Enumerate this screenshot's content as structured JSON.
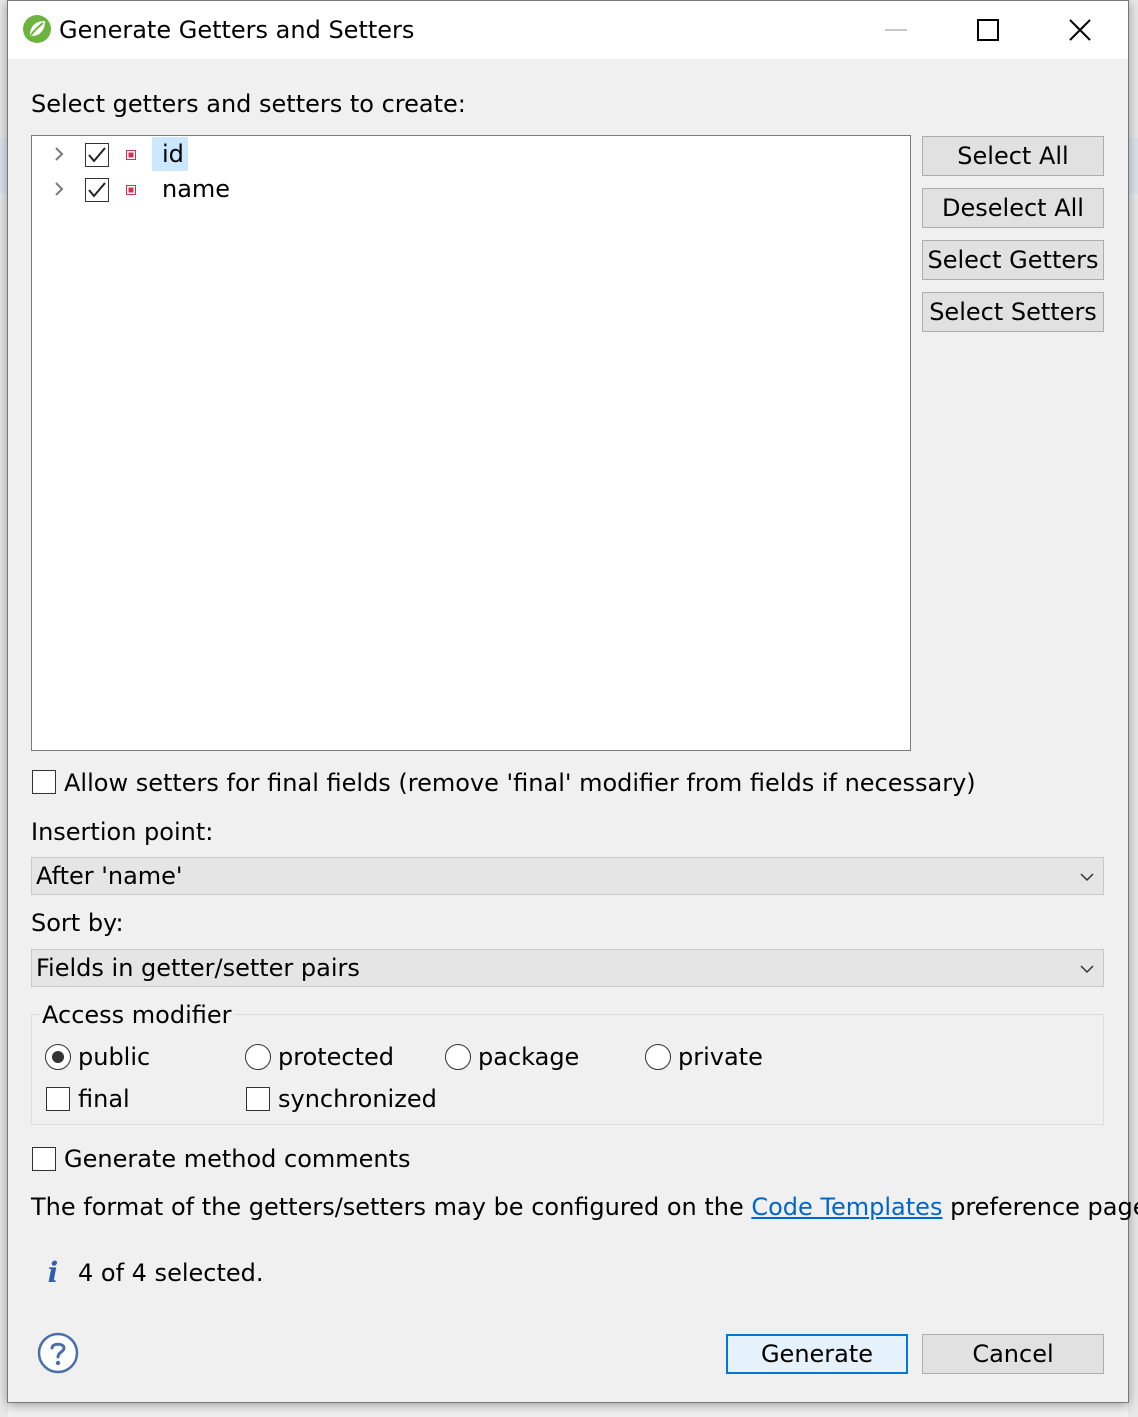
{
  "dialog": {
    "title": "Generate Getters and Setters",
    "minimize_icon": "minimize-icon",
    "maximize_icon": "maximize-icon",
    "close_icon": "close-icon"
  },
  "fields_section": {
    "label": "Select getters and setters to create:",
    "tree": [
      {
        "name": "id",
        "checked": true,
        "selected": true,
        "icon": "private-field-icon"
      },
      {
        "name": "name",
        "checked": true,
        "selected": false,
        "icon": "private-field-icon"
      }
    ]
  },
  "side_buttons": {
    "select_all": "Select All",
    "deselect_all": "Deselect All",
    "select_getters": "Select Getters",
    "select_setters": "Select Setters"
  },
  "allow_setters_final": {
    "label": "Allow setters for final fields (remove 'final' modifier from fields if necessary)",
    "checked": false
  },
  "insertion_point": {
    "label": "Insertion point:",
    "value": "After 'name'"
  },
  "sort_by": {
    "label": "Sort by:",
    "value": "Fields in getter/setter pairs"
  },
  "access_modifier": {
    "title": "Access modifier",
    "options": [
      "public",
      "protected",
      "package",
      "private"
    ],
    "selected": "public",
    "final_label": "final",
    "synchronized_label": "synchronized",
    "final_checked": false,
    "synchronized_checked": false
  },
  "generate_comments": {
    "label": "Generate method comments",
    "checked": false
  },
  "format_note": {
    "prefix": "The format of the getters/setters may be configured on the ",
    "link": "Code Templates",
    "suffix": " preference page."
  },
  "status": {
    "icon": "info-icon",
    "text": "4 of 4 selected."
  },
  "footer": {
    "help_icon": "help-icon",
    "generate_label": "Generate",
    "cancel_label": "Cancel"
  },
  "colors": {
    "dialog_bg": "#f0f0f0",
    "selection": "#cce8ff",
    "default_button_border": "#0078d7",
    "link": "#0066cc",
    "field_icon": "#d32f4f",
    "app_icon": "#6db33f"
  }
}
